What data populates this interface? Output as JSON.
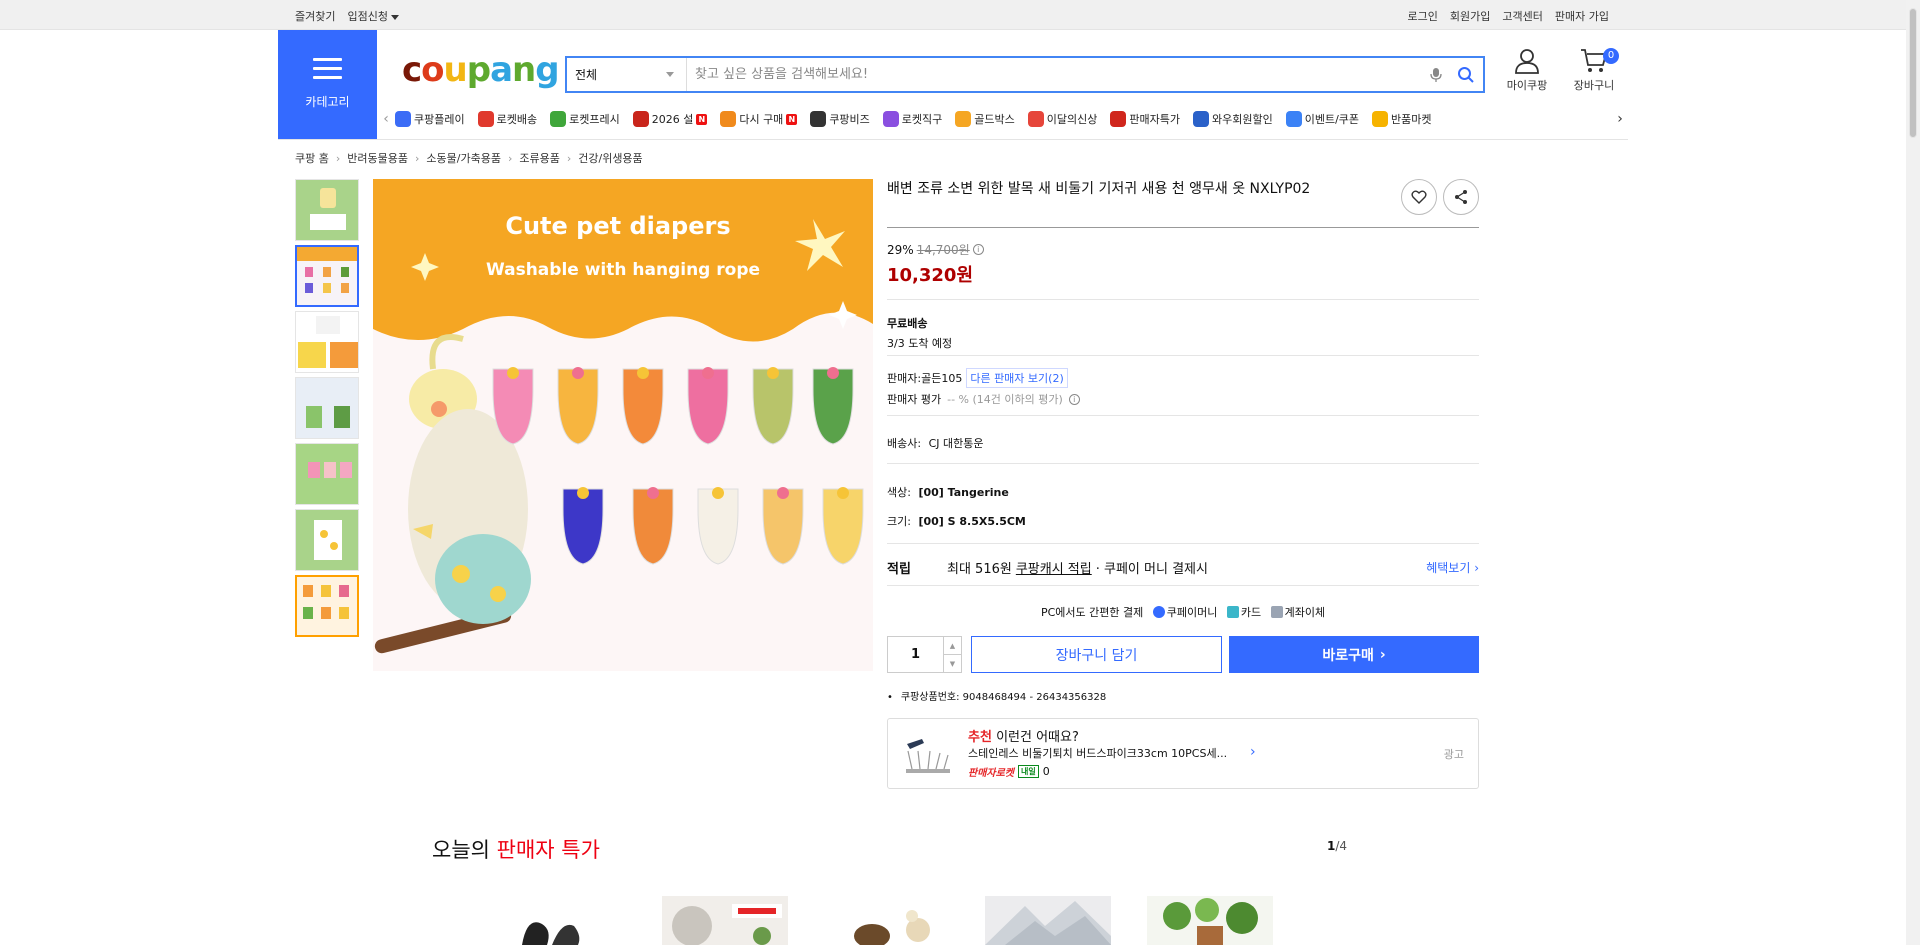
{
  "topbar": {
    "left": [
      "즐겨찾기",
      "입점신청"
    ],
    "right": [
      "로그인",
      "회원가입",
      "고객센터",
      "판매자 가입"
    ]
  },
  "header": {
    "category_label": "카테고리",
    "logo": "coupang",
    "search": {
      "category": "전체",
      "placeholder": "찾고 싶은 상품을 검색해보세요!"
    },
    "mycoupang": "마이쿠팡",
    "cart": "장바구니",
    "cart_count": "0"
  },
  "menu": [
    {
      "label": "쿠팡플레이",
      "color": "#3b6cf6",
      "badge": ""
    },
    {
      "label": "로켓배송",
      "color": "#e0392d",
      "badge": ""
    },
    {
      "label": "로켓프레시",
      "color": "#3fa63a",
      "badge": ""
    },
    {
      "label": "2026 설",
      "color": "#c9251b",
      "badge": "N"
    },
    {
      "label": "다시 구매",
      "color": "#f08a1c",
      "badge": "N"
    },
    {
      "label": "쿠팡비즈",
      "color": "#333333",
      "badge": ""
    },
    {
      "label": "로켓직구",
      "color": "#8a4fe0",
      "badge": ""
    },
    {
      "label": "골드박스",
      "color": "#f5a623",
      "badge": ""
    },
    {
      "label": "이달의신상",
      "color": "#e6453a",
      "badge": ""
    },
    {
      "label": "판매자특가",
      "color": "#d0261c",
      "badge": ""
    },
    {
      "label": "와우회원할인",
      "color": "#2a61c9",
      "badge": ""
    },
    {
      "label": "이벤트/쿠폰",
      "color": "#3b82f6",
      "badge": ""
    },
    {
      "label": "반품마켓",
      "color": "#f6b300",
      "badge": ""
    }
  ],
  "breadcrumb": [
    "쿠팡 홈",
    "반려동물용품",
    "소동물/가축용품",
    "조류용품",
    "건강/위생용품"
  ],
  "product": {
    "title": "배변 조류 소변 위한 발목 새 비둘기 기저귀 새용 천 앵무새 옷 NXLYP02",
    "discount": "29%",
    "original_price": "14,700원",
    "sale_price": "10,320원",
    "shipping_title": "무료배송",
    "arrival": "3/3 도착 예정",
    "seller_label": "판매자:",
    "seller": "골든105",
    "other_seller": "다른 판매자 보기(2)",
    "seller_rating_label": "판매자 평가",
    "seller_rating": "-- % (14건 이하의 평가)",
    "courier_label": "배송사:",
    "courier": "CJ 대한통운",
    "color_label": "색상:",
    "color_value": "[00] Tangerine",
    "size_label": "크기:",
    "size_value": "[00] S 8.5X5.5CM",
    "reward_tag": "적립",
    "reward_pre": "최대 516원",
    "reward_link": "쿠팡캐시 적립",
    "reward_post": "· 쿠페이 머니 결제시",
    "benefit": "혜택보기 ›",
    "pay_text": "PC에서도 간편한 결제",
    "pay_methods": [
      "쿠페이머니",
      "카드",
      "계좌이체"
    ],
    "qty": "1",
    "cart_btn": "장바구니 담기",
    "buy_btn": "바로구매",
    "product_no": "쿠팡상품번호: 9048468494 - 26434356328"
  },
  "image_text": {
    "line1": "Cute pet diapers",
    "line2": "Washable with hanging rope"
  },
  "recommend": {
    "red": "추천",
    "rest": "이런건 어때요?",
    "name": "스테인레스 비둘기퇴치 버드스파이크33cm 10PCS세...",
    "badge": "판매자로켓",
    "tomorrow": "내일",
    "count": "0",
    "ad": "광고"
  },
  "today": {
    "pre": "오늘의",
    "red": "판매자 특가",
    "page": "1",
    "total": "/4"
  },
  "colors": {
    "accent": "#346aff",
    "price": "#ae0000"
  }
}
